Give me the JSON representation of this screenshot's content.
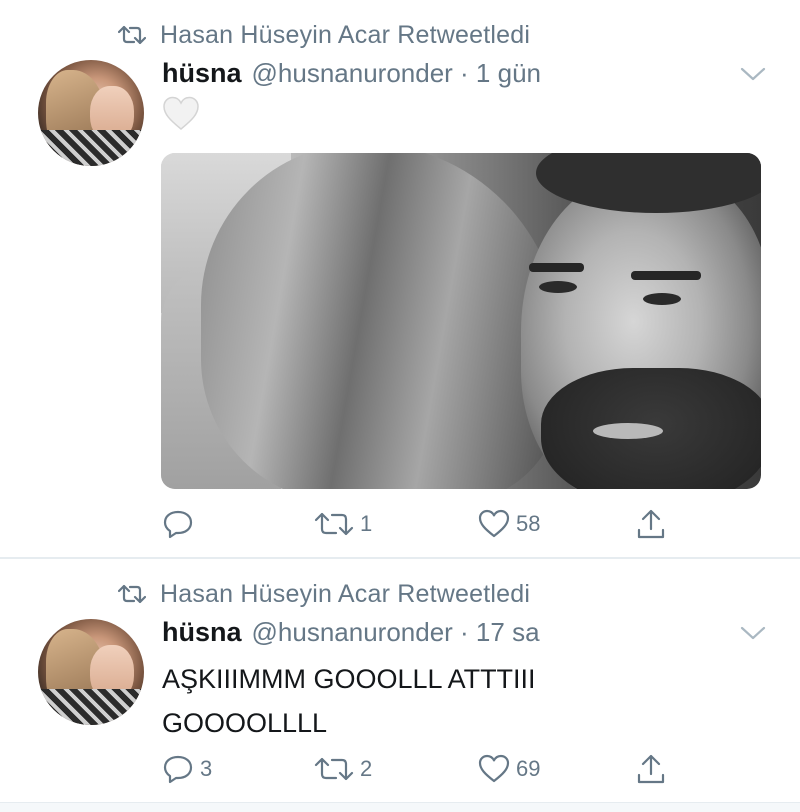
{
  "tweets": [
    {
      "retweet_by": "Hasan Hüseyin Acar Retweetledi",
      "name": "hüsna",
      "handle_time": "@husnanuronder · 1 gün",
      "emoji": "white-heart",
      "has_media": true,
      "counts": {
        "reply": "",
        "retweet": "1",
        "like": "58"
      }
    },
    {
      "retweet_by": "Hasan Hüseyin Acar Retweetledi",
      "name": "hüsna",
      "handle_time": "@husnanuronder · 17 sa",
      "text": "AŞKIIIMMM GOOOLLL ATTTIII GOOOOLLLL",
      "has_media": false,
      "counts": {
        "reply": "3",
        "retweet": "2",
        "like": "69"
      }
    }
  ],
  "colors": {
    "text": "#14171a",
    "secondary": "#657786",
    "divider": "#e6ecf0"
  }
}
